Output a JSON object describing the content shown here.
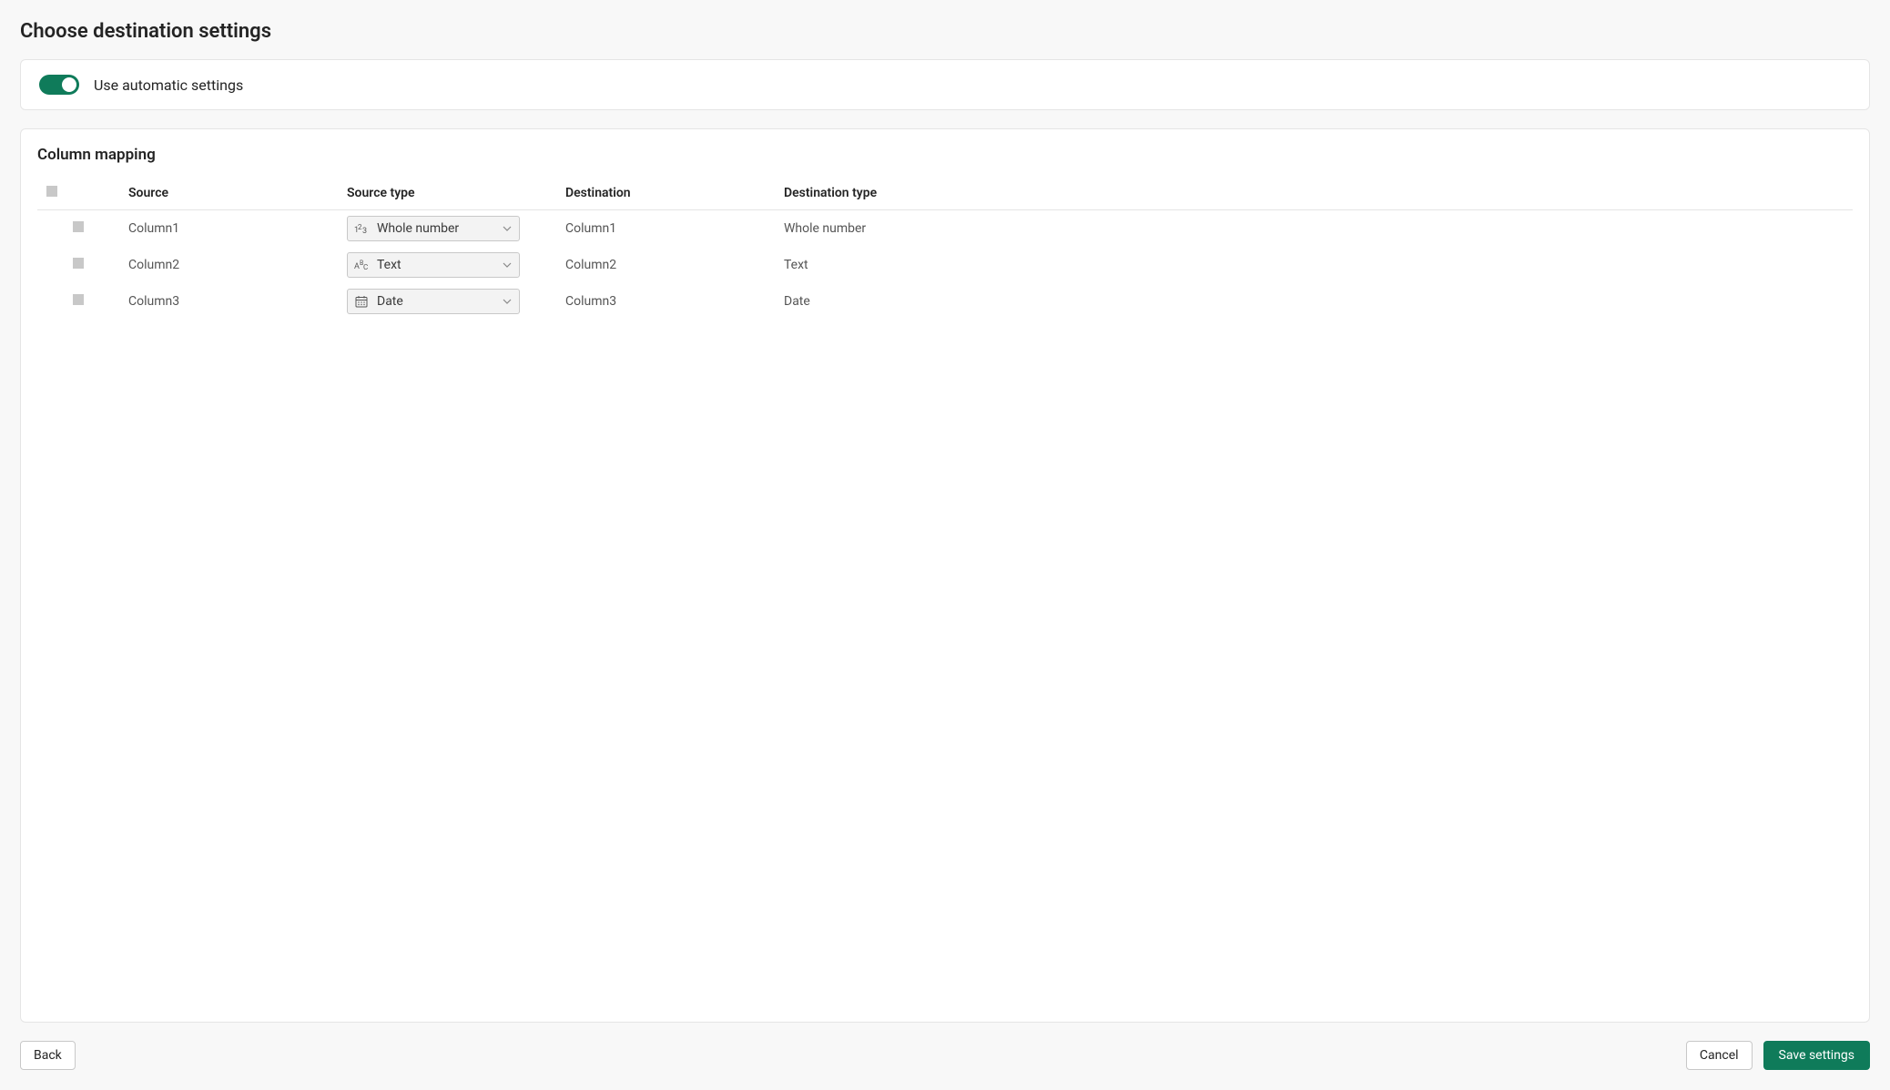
{
  "page": {
    "title": "Choose destination settings"
  },
  "toggle": {
    "label": "Use automatic settings",
    "on": true
  },
  "mapping": {
    "title": "Column mapping",
    "headers": {
      "source": "Source",
      "source_type": "Source type",
      "destination": "Destination",
      "destination_type": "Destination type"
    },
    "rows": [
      {
        "source": "Column1",
        "source_type": "Whole number",
        "source_type_icon": "number-icon",
        "destination": "Column1",
        "destination_type": "Whole number"
      },
      {
        "source": "Column2",
        "source_type": "Text",
        "source_type_icon": "text-icon",
        "destination": "Column2",
        "destination_type": "Text"
      },
      {
        "source": "Column3",
        "source_type": "Date",
        "source_type_icon": "calendar-icon",
        "destination": "Column3",
        "destination_type": "Date"
      }
    ]
  },
  "footer": {
    "back": "Back",
    "cancel": "Cancel",
    "save": "Save settings"
  },
  "colors": {
    "accent": "#0f7b5a",
    "border": "#e5e5e5",
    "bg": "#f8f8f8"
  }
}
